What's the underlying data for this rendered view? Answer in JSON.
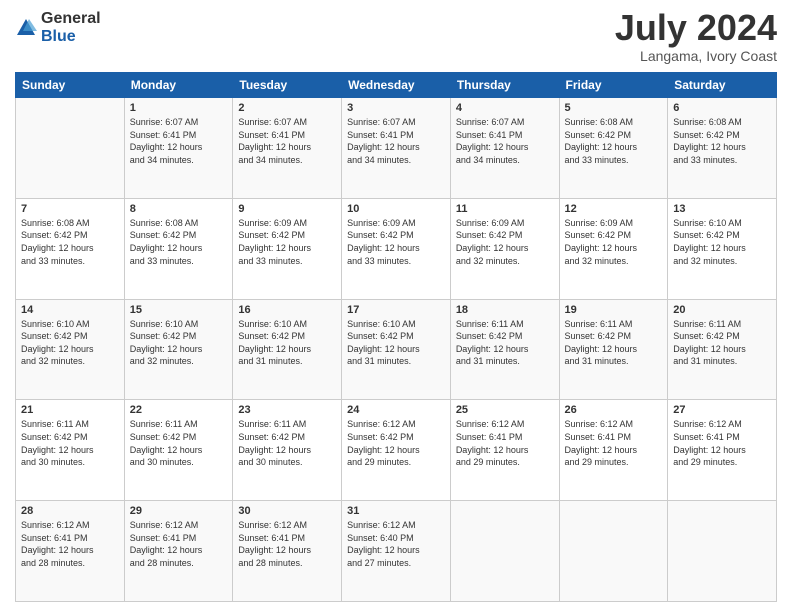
{
  "header": {
    "logo_general": "General",
    "logo_blue": "Blue",
    "month_title": "July 2024",
    "location": "Langama, Ivory Coast"
  },
  "columns": [
    "Sunday",
    "Monday",
    "Tuesday",
    "Wednesday",
    "Thursday",
    "Friday",
    "Saturday"
  ],
  "weeks": [
    [
      {
        "day": "",
        "info": ""
      },
      {
        "day": "1",
        "info": "Sunrise: 6:07 AM\nSunset: 6:41 PM\nDaylight: 12 hours\nand 34 minutes."
      },
      {
        "day": "2",
        "info": "Sunrise: 6:07 AM\nSunset: 6:41 PM\nDaylight: 12 hours\nand 34 minutes."
      },
      {
        "day": "3",
        "info": "Sunrise: 6:07 AM\nSunset: 6:41 PM\nDaylight: 12 hours\nand 34 minutes."
      },
      {
        "day": "4",
        "info": "Sunrise: 6:07 AM\nSunset: 6:41 PM\nDaylight: 12 hours\nand 34 minutes."
      },
      {
        "day": "5",
        "info": "Sunrise: 6:08 AM\nSunset: 6:42 PM\nDaylight: 12 hours\nand 33 minutes."
      },
      {
        "day": "6",
        "info": "Sunrise: 6:08 AM\nSunset: 6:42 PM\nDaylight: 12 hours\nand 33 minutes."
      }
    ],
    [
      {
        "day": "7",
        "info": ""
      },
      {
        "day": "8",
        "info": "Sunrise: 6:08 AM\nSunset: 6:42 PM\nDaylight: 12 hours\nand 33 minutes."
      },
      {
        "day": "9",
        "info": "Sunrise: 6:09 AM\nSunset: 6:42 PM\nDaylight: 12 hours\nand 33 minutes."
      },
      {
        "day": "10",
        "info": "Sunrise: 6:09 AM\nSunset: 6:42 PM\nDaylight: 12 hours\nand 33 minutes."
      },
      {
        "day": "11",
        "info": "Sunrise: 6:09 AM\nSunset: 6:42 PM\nDaylight: 12 hours\nand 32 minutes."
      },
      {
        "day": "12",
        "info": "Sunrise: 6:09 AM\nSunset: 6:42 PM\nDaylight: 12 hours\nand 32 minutes."
      },
      {
        "day": "13",
        "info": "Sunrise: 6:10 AM\nSunset: 6:42 PM\nDaylight: 12 hours\nand 32 minutes."
      }
    ],
    [
      {
        "day": "14",
        "info": ""
      },
      {
        "day": "15",
        "info": "Sunrise: 6:10 AM\nSunset: 6:42 PM\nDaylight: 12 hours\nand 32 minutes."
      },
      {
        "day": "16",
        "info": "Sunrise: 6:10 AM\nSunset: 6:42 PM\nDaylight: 12 hours\nand 31 minutes."
      },
      {
        "day": "17",
        "info": "Sunrise: 6:10 AM\nSunset: 6:42 PM\nDaylight: 12 hours\nand 31 minutes."
      },
      {
        "day": "18",
        "info": "Sunrise: 6:11 AM\nSunset: 6:42 PM\nDaylight: 12 hours\nand 31 minutes."
      },
      {
        "day": "19",
        "info": "Sunrise: 6:11 AM\nSunset: 6:42 PM\nDaylight: 12 hours\nand 31 minutes."
      },
      {
        "day": "20",
        "info": "Sunrise: 6:11 AM\nSunset: 6:42 PM\nDaylight: 12 hours\nand 31 minutes."
      }
    ],
    [
      {
        "day": "21",
        "info": ""
      },
      {
        "day": "22",
        "info": "Sunrise: 6:11 AM\nSunset: 6:42 PM\nDaylight: 12 hours\nand 30 minutes."
      },
      {
        "day": "23",
        "info": "Sunrise: 6:11 AM\nSunset: 6:42 PM\nDaylight: 12 hours\nand 30 minutes."
      },
      {
        "day": "24",
        "info": "Sunrise: 6:12 AM\nSunset: 6:42 PM\nDaylight: 12 hours\nand 29 minutes."
      },
      {
        "day": "25",
        "info": "Sunrise: 6:12 AM\nSunset: 6:41 PM\nDaylight: 12 hours\nand 29 minutes."
      },
      {
        "day": "26",
        "info": "Sunrise: 6:12 AM\nSunset: 6:41 PM\nDaylight: 12 hours\nand 29 minutes."
      },
      {
        "day": "27",
        "info": "Sunrise: 6:12 AM\nSunset: 6:41 PM\nDaylight: 12 hours\nand 29 minutes."
      }
    ],
    [
      {
        "day": "28",
        "info": "Sunrise: 6:12 AM\nSunset: 6:41 PM\nDaylight: 12 hours\nand 28 minutes."
      },
      {
        "day": "29",
        "info": "Sunrise: 6:12 AM\nSunset: 6:41 PM\nDaylight: 12 hours\nand 28 minutes."
      },
      {
        "day": "30",
        "info": "Sunrise: 6:12 AM\nSunset: 6:41 PM\nDaylight: 12 hours\nand 28 minutes."
      },
      {
        "day": "31",
        "info": "Sunrise: 6:12 AM\nSunset: 6:40 PM\nDaylight: 12 hours\nand 27 minutes."
      },
      {
        "day": "",
        "info": ""
      },
      {
        "day": "",
        "info": ""
      },
      {
        "day": "",
        "info": ""
      }
    ]
  ],
  "week7_sunday": "Sunrise: 6:08 AM\nSunset: 6:42 PM\nDaylight: 12 hours\nand 33 minutes.",
  "week14_sunday": "Sunrise: 6:10 AM\nSunset: 6:42 PM\nDaylight: 12 hours\nand 32 minutes.",
  "week21_sunday": "Sunrise: 6:11 AM\nSunset: 6:42 PM\nDaylight: 12 hours\nand 30 minutes."
}
